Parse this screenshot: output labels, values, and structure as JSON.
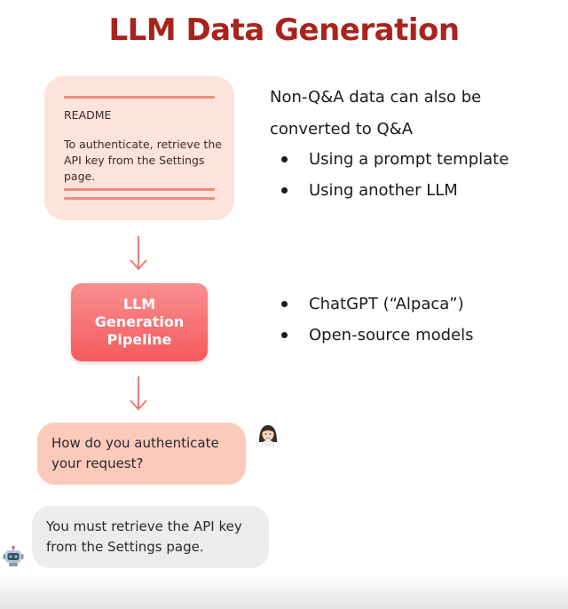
{
  "colors": {
    "title": "#a8231c",
    "readme_bg": "#fde3dc",
    "readme_rule": "#f08a80",
    "arrow": "#ee7d74",
    "pipeline_top": "#f98f8f",
    "pipeline_bottom": "#f45a5e",
    "question_bg": "#fbcabb",
    "answer_bg": "#ececec"
  },
  "slide": {
    "title": "LLM Data Generation"
  },
  "readme": {
    "title": "README",
    "body": "To authenticate, retrieve the API key from the Settings page."
  },
  "pipeline": {
    "label_line1": "LLM",
    "label_line2": "Generation",
    "label_line3": "Pipeline"
  },
  "chat": {
    "question": "How do you authenticate your request?",
    "answer": "You must retrieve the API key from the Settings page.",
    "user_avatar_icon": "woman-avatar-icon",
    "bot_avatar_icon": "robot-avatar-icon"
  },
  "notes": {
    "intro": "Non-Q&A data can also be converted to Q&A",
    "bullets_1": [
      "Using a prompt template",
      "Using another LLM"
    ],
    "bullets_2": [
      "ChatGPT (“Alpaca”)",
      "Open-source models"
    ]
  }
}
